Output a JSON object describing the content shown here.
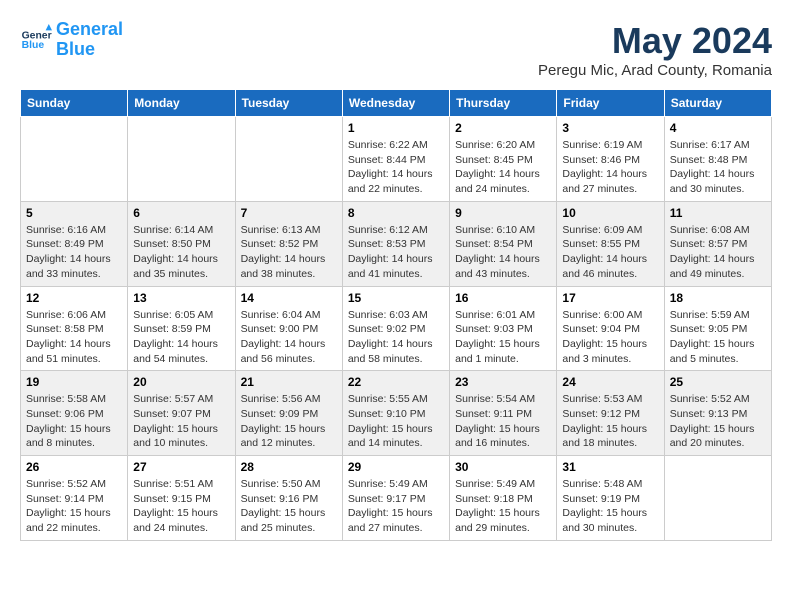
{
  "logo": {
    "line1": "General",
    "line2": "Blue"
  },
  "title": "May 2024",
  "subtitle": "Peregu Mic, Arad County, Romania",
  "days_of_week": [
    "Sunday",
    "Monday",
    "Tuesday",
    "Wednesday",
    "Thursday",
    "Friday",
    "Saturday"
  ],
  "weeks": [
    [
      {
        "day": "",
        "info": ""
      },
      {
        "day": "",
        "info": ""
      },
      {
        "day": "",
        "info": ""
      },
      {
        "day": "1",
        "info": "Sunrise: 6:22 AM\nSunset: 8:44 PM\nDaylight: 14 hours\nand 22 minutes."
      },
      {
        "day": "2",
        "info": "Sunrise: 6:20 AM\nSunset: 8:45 PM\nDaylight: 14 hours\nand 24 minutes."
      },
      {
        "day": "3",
        "info": "Sunrise: 6:19 AM\nSunset: 8:46 PM\nDaylight: 14 hours\nand 27 minutes."
      },
      {
        "day": "4",
        "info": "Sunrise: 6:17 AM\nSunset: 8:48 PM\nDaylight: 14 hours\nand 30 minutes."
      }
    ],
    [
      {
        "day": "5",
        "info": "Sunrise: 6:16 AM\nSunset: 8:49 PM\nDaylight: 14 hours\nand 33 minutes."
      },
      {
        "day": "6",
        "info": "Sunrise: 6:14 AM\nSunset: 8:50 PM\nDaylight: 14 hours\nand 35 minutes."
      },
      {
        "day": "7",
        "info": "Sunrise: 6:13 AM\nSunset: 8:52 PM\nDaylight: 14 hours\nand 38 minutes."
      },
      {
        "day": "8",
        "info": "Sunrise: 6:12 AM\nSunset: 8:53 PM\nDaylight: 14 hours\nand 41 minutes."
      },
      {
        "day": "9",
        "info": "Sunrise: 6:10 AM\nSunset: 8:54 PM\nDaylight: 14 hours\nand 43 minutes."
      },
      {
        "day": "10",
        "info": "Sunrise: 6:09 AM\nSunset: 8:55 PM\nDaylight: 14 hours\nand 46 minutes."
      },
      {
        "day": "11",
        "info": "Sunrise: 6:08 AM\nSunset: 8:57 PM\nDaylight: 14 hours\nand 49 minutes."
      }
    ],
    [
      {
        "day": "12",
        "info": "Sunrise: 6:06 AM\nSunset: 8:58 PM\nDaylight: 14 hours\nand 51 minutes."
      },
      {
        "day": "13",
        "info": "Sunrise: 6:05 AM\nSunset: 8:59 PM\nDaylight: 14 hours\nand 54 minutes."
      },
      {
        "day": "14",
        "info": "Sunrise: 6:04 AM\nSunset: 9:00 PM\nDaylight: 14 hours\nand 56 minutes."
      },
      {
        "day": "15",
        "info": "Sunrise: 6:03 AM\nSunset: 9:02 PM\nDaylight: 14 hours\nand 58 minutes."
      },
      {
        "day": "16",
        "info": "Sunrise: 6:01 AM\nSunset: 9:03 PM\nDaylight: 15 hours\nand 1 minute."
      },
      {
        "day": "17",
        "info": "Sunrise: 6:00 AM\nSunset: 9:04 PM\nDaylight: 15 hours\nand 3 minutes."
      },
      {
        "day": "18",
        "info": "Sunrise: 5:59 AM\nSunset: 9:05 PM\nDaylight: 15 hours\nand 5 minutes."
      }
    ],
    [
      {
        "day": "19",
        "info": "Sunrise: 5:58 AM\nSunset: 9:06 PM\nDaylight: 15 hours\nand 8 minutes."
      },
      {
        "day": "20",
        "info": "Sunrise: 5:57 AM\nSunset: 9:07 PM\nDaylight: 15 hours\nand 10 minutes."
      },
      {
        "day": "21",
        "info": "Sunrise: 5:56 AM\nSunset: 9:09 PM\nDaylight: 15 hours\nand 12 minutes."
      },
      {
        "day": "22",
        "info": "Sunrise: 5:55 AM\nSunset: 9:10 PM\nDaylight: 15 hours\nand 14 minutes."
      },
      {
        "day": "23",
        "info": "Sunrise: 5:54 AM\nSunset: 9:11 PM\nDaylight: 15 hours\nand 16 minutes."
      },
      {
        "day": "24",
        "info": "Sunrise: 5:53 AM\nSunset: 9:12 PM\nDaylight: 15 hours\nand 18 minutes."
      },
      {
        "day": "25",
        "info": "Sunrise: 5:52 AM\nSunset: 9:13 PM\nDaylight: 15 hours\nand 20 minutes."
      }
    ],
    [
      {
        "day": "26",
        "info": "Sunrise: 5:52 AM\nSunset: 9:14 PM\nDaylight: 15 hours\nand 22 minutes."
      },
      {
        "day": "27",
        "info": "Sunrise: 5:51 AM\nSunset: 9:15 PM\nDaylight: 15 hours\nand 24 minutes."
      },
      {
        "day": "28",
        "info": "Sunrise: 5:50 AM\nSunset: 9:16 PM\nDaylight: 15 hours\nand 25 minutes."
      },
      {
        "day": "29",
        "info": "Sunrise: 5:49 AM\nSunset: 9:17 PM\nDaylight: 15 hours\nand 27 minutes."
      },
      {
        "day": "30",
        "info": "Sunrise: 5:49 AM\nSunset: 9:18 PM\nDaylight: 15 hours\nand 29 minutes."
      },
      {
        "day": "31",
        "info": "Sunrise: 5:48 AM\nSunset: 9:19 PM\nDaylight: 15 hours\nand 30 minutes."
      },
      {
        "day": "",
        "info": ""
      }
    ]
  ]
}
